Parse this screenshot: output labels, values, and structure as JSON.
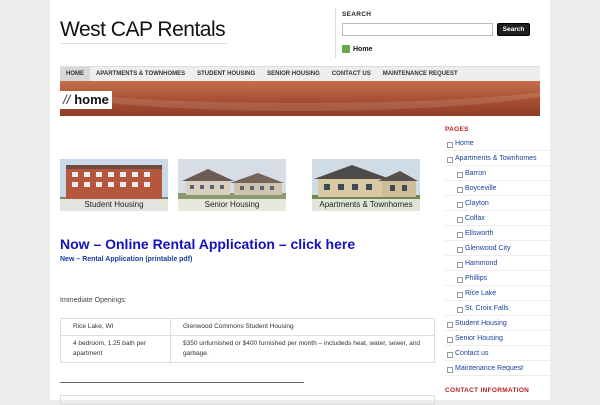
{
  "site": {
    "title": "West CAP Rentals"
  },
  "search": {
    "label": "SEARCH",
    "placeholder": "",
    "button": "Search"
  },
  "home_link": {
    "label": "Home"
  },
  "nav": [
    "HOME",
    "APARTMENTS & TOWNHOMES",
    "STUDENT HOUSING",
    "SENIOR HOUSING",
    "CONTACT US",
    "MAINTENANCE REQUEST"
  ],
  "banner": {
    "prefix": "//",
    "title": "home"
  },
  "thumbnails": [
    "Student Housing",
    "Senior Housing",
    "Apartments & Townhomes"
  ],
  "apply": {
    "link": "Now – Online Rental Application – click here",
    "new_prefix": "New –",
    "new_link": "Rental Application (printable pdf)"
  },
  "openings": {
    "heading": "Immediate Openings:",
    "rows": [
      [
        "Rice Lake, WI",
        "Glenwood Commons Student Housing"
      ],
      [
        "4 bedroom, 1.25 bath per apartment",
        "$350 unfurnished or $400 furnished per month – includeds heat, water, sewer, and garbage."
      ]
    ]
  },
  "sidebar": {
    "pages_heading": "PAGES",
    "items": [
      {
        "label": "Home",
        "sub": false
      },
      {
        "label": "Apartments & Townhomes",
        "sub": false
      },
      {
        "label": "Barron",
        "sub": true
      },
      {
        "label": "Boyceville",
        "sub": true
      },
      {
        "label": "Clayton",
        "sub": true
      },
      {
        "label": "Colfax",
        "sub": true
      },
      {
        "label": "Ellsworth",
        "sub": true
      },
      {
        "label": "Glenwood City",
        "sub": true
      },
      {
        "label": "Hammond",
        "sub": true
      },
      {
        "label": "Phillips",
        "sub": true
      },
      {
        "label": "Rice Lake",
        "sub": true
      },
      {
        "label": "St. Croix Falls",
        "sub": true
      },
      {
        "label": "Student Housing",
        "sub": false
      },
      {
        "label": "Senior Housing",
        "sub": false
      },
      {
        "label": "Contact us",
        "sub": false
      },
      {
        "label": "Maintenance Request",
        "sub": false
      }
    ],
    "contact_heading": "CONTACT INFORMATION"
  }
}
